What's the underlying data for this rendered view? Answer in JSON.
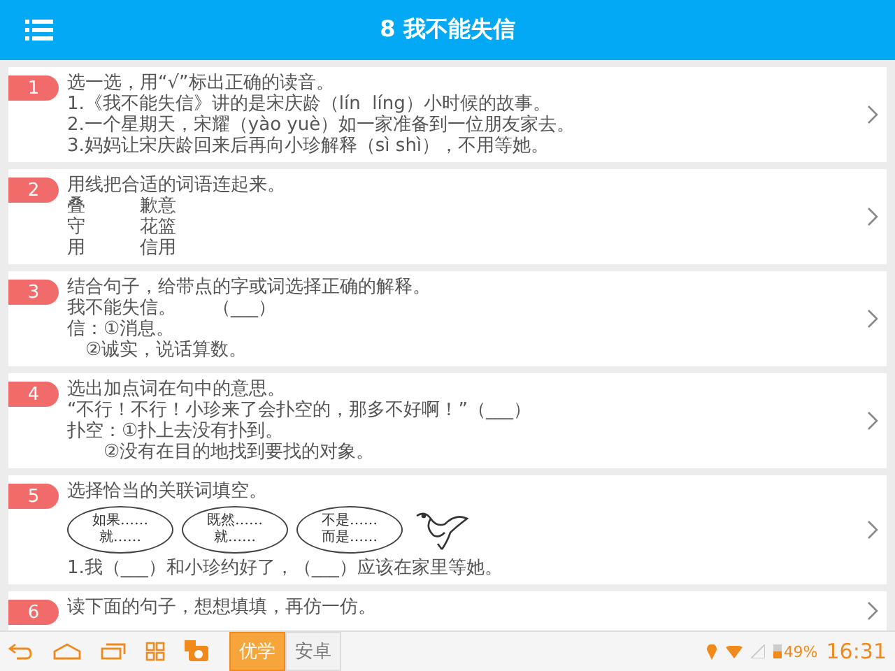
{
  "header": {
    "title": "8 我不能失信"
  },
  "questions": [
    {
      "number": "1",
      "kind": "text",
      "lines": [
        "选一选，用“√”标出正确的读音。",
        "1.《我不能失信》讲的是宋庆龄（lín  líng）小时候的故事。",
        "2.一个星期天，宋耀（yào yuè）如一家准备到一位朋友家去。",
        "3.妈妈让宋庆龄回来后再向小珍解释（sì shì），不用等她。"
      ]
    },
    {
      "number": "2",
      "kind": "pairs",
      "lines": [
        "用线把合适的词语连起来。"
      ],
      "pairs": [
        [
          "叠",
          "歉意"
        ],
        [
          "守",
          "花篮"
        ],
        [
          "用",
          "信用"
        ]
      ]
    },
    {
      "number": "3",
      "kind": "text",
      "lines": [
        "结合句子，给带点的字或词选择正确的解释。",
        "我不能失信。　　（___）",
        "信：①消息。",
        "　②诚实，说话算数。"
      ]
    },
    {
      "number": "4",
      "kind": "text",
      "lines": [
        "选出加点词在句中的意思。",
        "“不行！不行！小珍来了会扑空的，那多不好啊！”（___）",
        "扑空：①扑上去没有扑到。",
        "　　②没有在目的地找到要找的对象。"
      ]
    },
    {
      "number": "5",
      "kind": "choices",
      "lines": [
        "选择恰当的关联词填空。"
      ],
      "choices": [
        [
          "如果……",
          "就……"
        ],
        [
          "既然……",
          "就……"
        ],
        [
          "不是……",
          "而是……"
        ]
      ],
      "after": [
        "1.我（___）和小珍约好了，（___）应该在家里等她。"
      ]
    },
    {
      "number": "6",
      "kind": "text",
      "lines": [
        "读下面的句子，想想填填，再仿一仿。"
      ]
    }
  ],
  "nav_tabs": [
    {
      "label": "优学",
      "selected": true
    },
    {
      "label": "安卓",
      "selected": false
    }
  ],
  "status": {
    "battery": "49%",
    "time": "16:31"
  }
}
